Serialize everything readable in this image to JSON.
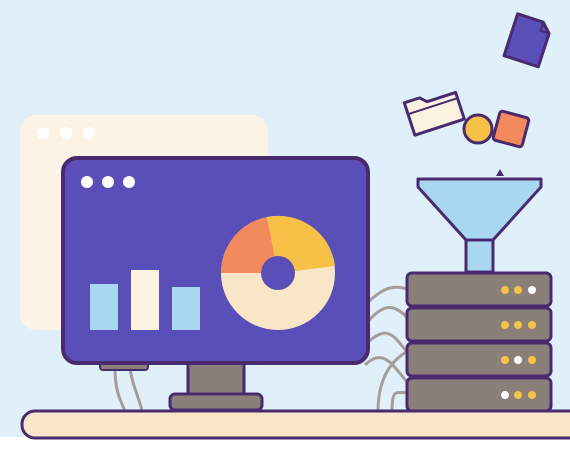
{
  "illustration": {
    "subject": "data-pipeline",
    "icons": [
      "back-window-icon",
      "monitor-icon",
      "bar-chart-icon",
      "donut-chart-icon",
      "funnel-icon",
      "server-stack-icon",
      "folder-icon",
      "document-icon",
      "circle-shape-icon",
      "square-shape-icon"
    ]
  },
  "colors": {
    "background": "#dff0fb",
    "outline": "#4a2a6e",
    "monitor_screen": "#5a4fb8",
    "back_window": "#fdf3e4",
    "window_dot": "#ffffff",
    "bar_blue": "#a9d7f0",
    "bar_cream": "#fbf2e0",
    "donut_base": "#f8e6c6",
    "donut_orange": "#f28a5e",
    "donut_yellow": "#f6c146",
    "stand": "#8a8079",
    "desk": "#f9e6c8",
    "server": "#8a8079",
    "server_led_yellow": "#f6c146",
    "server_led_white": "#ffffff",
    "funnel": "#a9d7f0",
    "cable": "#a59e98",
    "document": "#5a4fb8",
    "folder": "#fbf2e0",
    "shape_yellow": "#f6c146",
    "shape_orange": "#f28a5e"
  }
}
